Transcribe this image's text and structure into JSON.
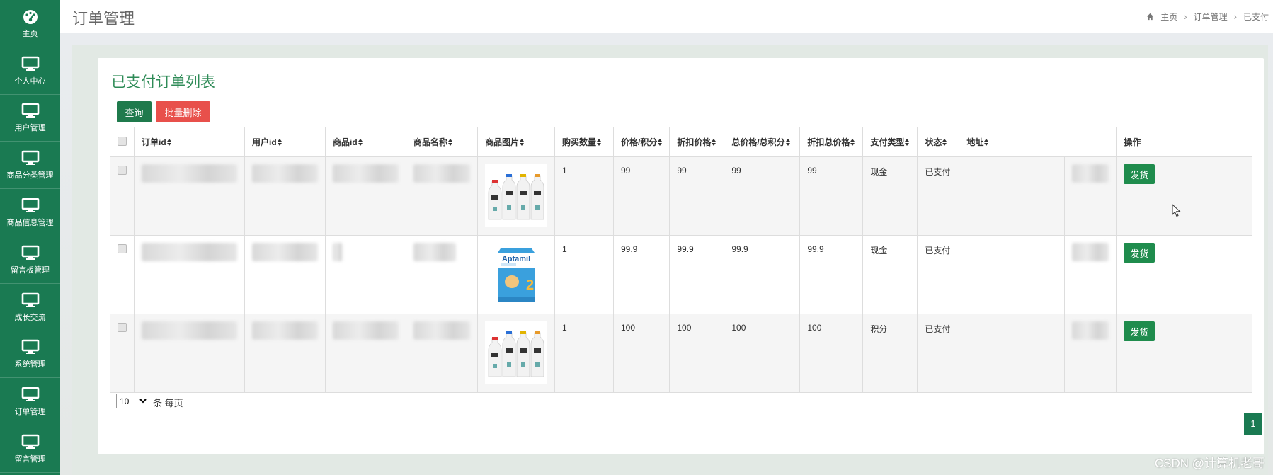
{
  "sidebar": {
    "items": [
      {
        "label": "主页",
        "icon": "dashboard-icon"
      },
      {
        "label": "个人中心",
        "icon": "monitor-icon"
      },
      {
        "label": "用户管理",
        "icon": "monitor-icon"
      },
      {
        "label": "商品分类管理",
        "icon": "monitor-icon"
      },
      {
        "label": "商品信息管理",
        "icon": "monitor-icon"
      },
      {
        "label": "留言板管理",
        "icon": "monitor-icon"
      },
      {
        "label": "成长交流",
        "icon": "monitor-icon"
      },
      {
        "label": "系统管理",
        "icon": "monitor-icon"
      },
      {
        "label": "订单管理",
        "icon": "monitor-icon"
      },
      {
        "label": "留言管理",
        "icon": "monitor-icon"
      }
    ]
  },
  "header": {
    "title": "订单管理",
    "breadcrumb": [
      "主页",
      "订单管理",
      "已支付"
    ]
  },
  "panel": {
    "title": "已支付订单列表",
    "query_label": "查询",
    "batch_delete_label": "批量删除"
  },
  "table": {
    "columns": [
      "订单id",
      "用户id",
      "商品id",
      "商品名称",
      "商品图片",
      "购买数量",
      "价格/积分",
      "折扣价格",
      "总价格/总积分",
      "折扣总价格",
      "支付类型",
      "状态",
      "地址",
      "操作"
    ],
    "rows": [
      {
        "quantity": "1",
        "price": "99",
        "discount_price": "99",
        "total": "99",
        "discount_total": "99",
        "pay_type": "现金",
        "status": "已支付",
        "image": "milk-bottles",
        "action": "发货"
      },
      {
        "quantity": "1",
        "price": "99.9",
        "discount_price": "99.9",
        "total": "99.9",
        "discount_total": "99.9",
        "pay_type": "现金",
        "status": "已支付",
        "image": "aptamil-can",
        "action": "发货",
        "brand_text": "Aptamil"
      },
      {
        "quantity": "1",
        "price": "100",
        "discount_price": "100",
        "total": "100",
        "discount_total": "100",
        "pay_type": "积分",
        "status": "已支付",
        "image": "milk-bottles",
        "action": "发货"
      }
    ]
  },
  "footer": {
    "page_size": "10",
    "page_size_suffix": "条 每页",
    "current_page": "1"
  },
  "watermark": "CSDN @计算机老哥",
  "colors": {
    "sidebar": "#1a7a52",
    "title_green": "#2e8b57",
    "delete_red": "#e8504b",
    "ship_green": "#1f8c4d"
  }
}
